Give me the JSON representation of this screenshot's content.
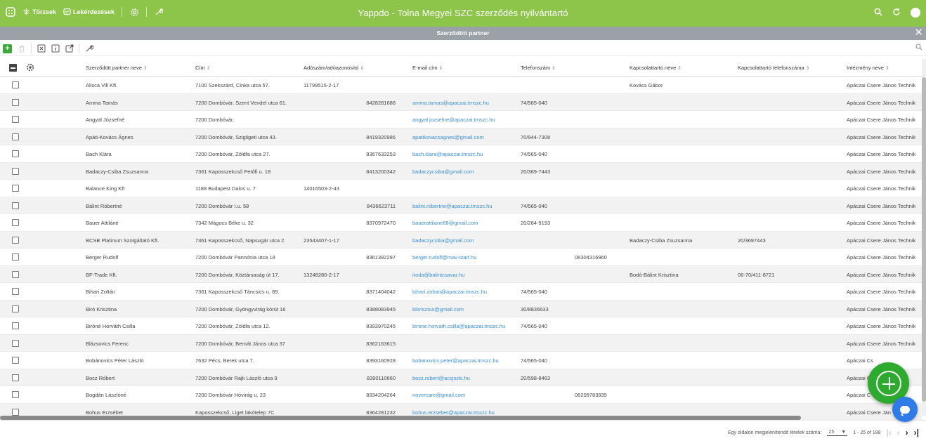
{
  "app": {
    "title": "Yappdo - Tolna Megyei SZC szerződés nyilvántartó",
    "nav": [
      {
        "label": "Törzsek",
        "icon": "tree-icon"
      },
      {
        "label": "Lekérdezések",
        "icon": "query-icon"
      }
    ],
    "colors": {
      "topbar": "#8dc54b",
      "subbar": "#9aa1a7",
      "link": "#3a8fd8",
      "fab": "#2eaa2e",
      "chat": "#2f7be8"
    }
  },
  "panel": {
    "title": "Szerződött partner"
  },
  "table": {
    "columns": [
      "Szerződött partner neve",
      "Cím",
      "Adószám/adóazonosító",
      "E-mail cím",
      "Telefonszám",
      "Kapcsolattartó neve",
      "Kapcsolattartó telefonszáma",
      "Intézmény neve"
    ],
    "rows": [
      [
        "Alisca Vill Kft.",
        "7100 Szekszárd, Cinka utca 57.",
        "11799515-2-17",
        "",
        "",
        "",
        "",
        "Kovács Gábor",
        "",
        "Apáczai Csere János Technik"
      ],
      [
        "Amma Tamás",
        "7200 Dombóvár, Szent Vendel utca 61.",
        "",
        "8428281688",
        "amma.tamas@apaczai.tmszc.hu",
        "74/565-040",
        "",
        "",
        "",
        "Apáczai Csere János Technik"
      ],
      [
        "Angyal Józsefné",
        "7200 Dombóvár,",
        "",
        "",
        "angyal.jozsefne@apaczai.tmszc.hu",
        "",
        "",
        "",
        "",
        "Apáczai Csere János Technik"
      ],
      [
        "Apáti-Kovács Ágnes",
        "7200 Dombóvár, Szigligeti utca 43.",
        "",
        "8419320986",
        "apatikovacsagnes@gmail.com",
        "70/944-7308",
        "",
        "",
        "",
        "Apáczai Csere János Technik"
      ],
      [
        "Bach Klára",
        "7200 Dombóvár, Zöldfa utca 27.",
        "",
        "8367633253",
        "bach.klara@apaczai.tmszc.hu",
        "74/565-040",
        "",
        "",
        "",
        "Apáczai Csere János Technik"
      ],
      [
        "Badaczy-Csiba Zsuzsanna",
        "7361 Kaposszekcső Petőfi u. 18",
        "",
        "8413200342",
        "badaczycsiba@gmail.com",
        "20/369-7443",
        "",
        "",
        "",
        "Apáczai Csere János Technik"
      ],
      [
        "Balance King Kft",
        "1188 Budapest Dalos u. 7",
        "14016503-2-43",
        "",
        "",
        "",
        "",
        "",
        "",
        "Apáczai Csere János Technik"
      ],
      [
        "Bálint Róbertné",
        "7200 Dombóvár I.u. 58",
        "",
        "8436623711",
        "balint.robertne@apaczai.tmszc.hu",
        "74/565-040",
        "",
        "",
        "",
        "Apáczai Csere János Technik"
      ],
      [
        "Bauer Attiláné",
        "7342 Mágocs Béke u. 32",
        "",
        "8370972470",
        "bauerattilane68@gmail.com",
        "20/264-9193",
        "",
        "",
        "",
        "Apáczai Csere János Technik"
      ],
      [
        "BCSB Platinum Szolgáltató Kft.",
        "7361 Kaposszekcső, Napsugár utca 2.",
        "23543407-1-17",
        "",
        "badaczycsiba@gmail.com",
        "",
        "",
        "Badaczy-Csiba Zsuzsanna",
        "20/3697443",
        "Apáczai Csere János Technik"
      ],
      [
        "Berger Rudolf",
        "7200 Dombóvár Pannónia utca 18",
        "",
        "8361392297",
        "berger.rudolf@mav-start.hu",
        "",
        "06304316960",
        "",
        "",
        "Apáczai Csere János Technik"
      ],
      [
        "BF-Trade Kft.",
        "7200 Dombóvár, Köztársaság út 17.",
        "13248280-2-17",
        "",
        "iroda@balintcsavar.hu",
        "",
        "",
        "Bodó-Bálint Krisztina",
        "06-70/411-8721",
        "Apáczai Csere János Technik"
      ],
      [
        "Bihari Zoltán",
        "7361 Kaposszekcső Táncsics u. 89.",
        "",
        "8371404042",
        "bihari.zoltan@apaczai.tmszc.hu",
        "74/565-040",
        "",
        "",
        "",
        "Apáczai Csere János Technik"
      ],
      [
        "Biró Krisztina",
        "7200 Dombóvár, Gyöngyvirág körút 16",
        "",
        "8388083945",
        "bikrisztus@gmail.com",
        "30/8836633",
        "",
        "",
        "",
        "Apáczai Csere János Technik"
      ],
      [
        "Biróné Horváth Csilla",
        "7200 Dombóvár, Zöldfa utca 12.",
        "",
        "8393970245",
        "birone.horvath.csilla@apaczai.tmszc.hu",
        "74/565-040",
        "",
        "",
        "",
        "Apáczai Csere János Technik"
      ],
      [
        "Blázsovics Ferenc",
        "7200 Dombóvár, Bernát János utca 37",
        "",
        "8362163615",
        "",
        "",
        "",
        "",
        "",
        "Apáczai Csere János Technik"
      ],
      [
        "Bobánovics Péter László",
        "7632 Pécs, Berek utca 7.",
        "",
        "8393160928",
        "bobanovics.peter@apaczai.tmszc.hu",
        "74/565-040",
        "",
        "",
        "",
        "Apáczai Cs"
      ],
      [
        "Bocz Róbert",
        "7200 Dombóvár Rajk László utca 9",
        "",
        "8390110660",
        "bocz.robert@acsjszki.hu",
        "20/598-8463",
        "",
        "",
        "",
        "Apáczai C"
      ],
      [
        "Bogdán Lászlóné",
        "7200 Dombóvár Hóvirág u. 23",
        "",
        "8334204264",
        "novercare@gmail.com",
        "",
        "06209783935",
        "",
        "",
        "Apáczai C"
      ],
      [
        "Bohus Erzsébet",
        "Kaposszekcső, Liget lakótelep 7C",
        "",
        "8364281232",
        "bohus.erzsebet@apaczai.tmszc.hu",
        "",
        "",
        "",
        "",
        "Apáczai Csere Ján"
      ]
    ]
  },
  "pagination": {
    "page_size_label": "Egy oldalon megjelenítendő tételek száma:",
    "page_size": "25",
    "range": "1 - 25 of 188"
  }
}
